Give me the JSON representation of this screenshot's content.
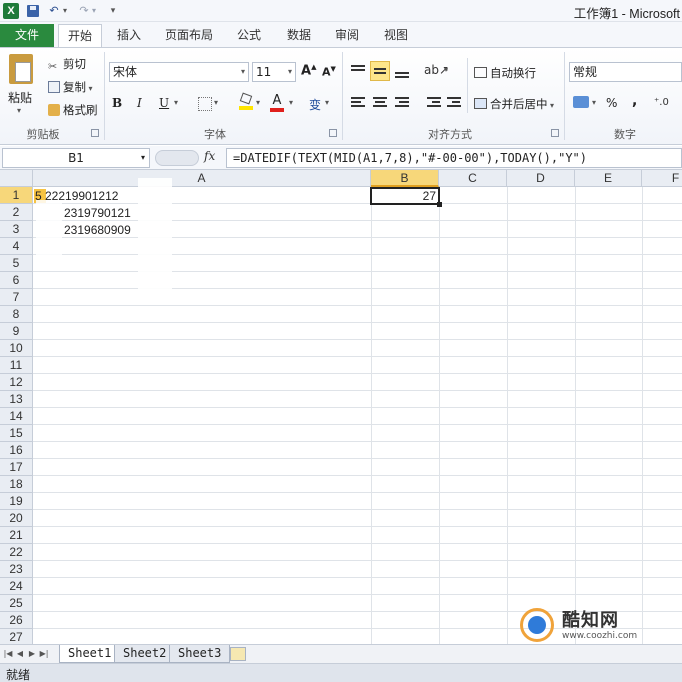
{
  "titlebar": {
    "title": "工作簿1 - Microsoft"
  },
  "quick_access": [
    "save-icon",
    "undo-icon",
    "redo-icon",
    "customize-icon"
  ],
  "tabs": [
    {
      "label": "文件"
    },
    {
      "label": "开始"
    },
    {
      "label": "插入"
    },
    {
      "label": "页面布局"
    },
    {
      "label": "公式"
    },
    {
      "label": "数据"
    },
    {
      "label": "审阅"
    },
    {
      "label": "视图"
    }
  ],
  "ribbon": {
    "clipboard": {
      "paste": "粘贴",
      "cut": "剪切",
      "copy": "复制",
      "format_painter": "格式刷",
      "group": "剪贴板"
    },
    "font": {
      "name": "宋体",
      "size": "11",
      "bold": "B",
      "italic": "I",
      "underline": "U",
      "grow": "A",
      "shrink": "A",
      "font_color": "A",
      "phonetic": "变",
      "group": "字体"
    },
    "alignment": {
      "wrap": "自动换行",
      "merge": "合并后居中",
      "group": "对齐方式"
    },
    "number": {
      "format": "常规",
      "percent": "%",
      "comma": ",",
      "group": "数字"
    }
  },
  "formula_bar": {
    "name_box": "B1",
    "fx": "fx",
    "formula": "=DATEDIF(TEXT(MID(A1,7,8),\"#-00-00\"),TODAY(),\"Y\")"
  },
  "grid": {
    "columns": [
      "A",
      "B",
      "C",
      "D",
      "E",
      "F"
    ],
    "rows": [
      "1",
      "2",
      "3",
      "4",
      "5",
      "6",
      "7",
      "8",
      "9",
      "10",
      "11",
      "12",
      "13",
      "14",
      "15",
      "16",
      "17",
      "18",
      "19",
      "20",
      "21",
      "22",
      "23",
      "24",
      "25",
      "26",
      "27"
    ],
    "cells": {
      "A1": "5        22219901212",
      "A2": "2319790121",
      "A3": "2319680909",
      "B1": "27"
    },
    "selected": "B1"
  },
  "sheets": [
    "Sheet1",
    "Sheet2",
    "Sheet3"
  ],
  "status": {
    "text": "就绪"
  },
  "watermark": {
    "name": "酷知网",
    "url": "www.coozhi.com"
  }
}
